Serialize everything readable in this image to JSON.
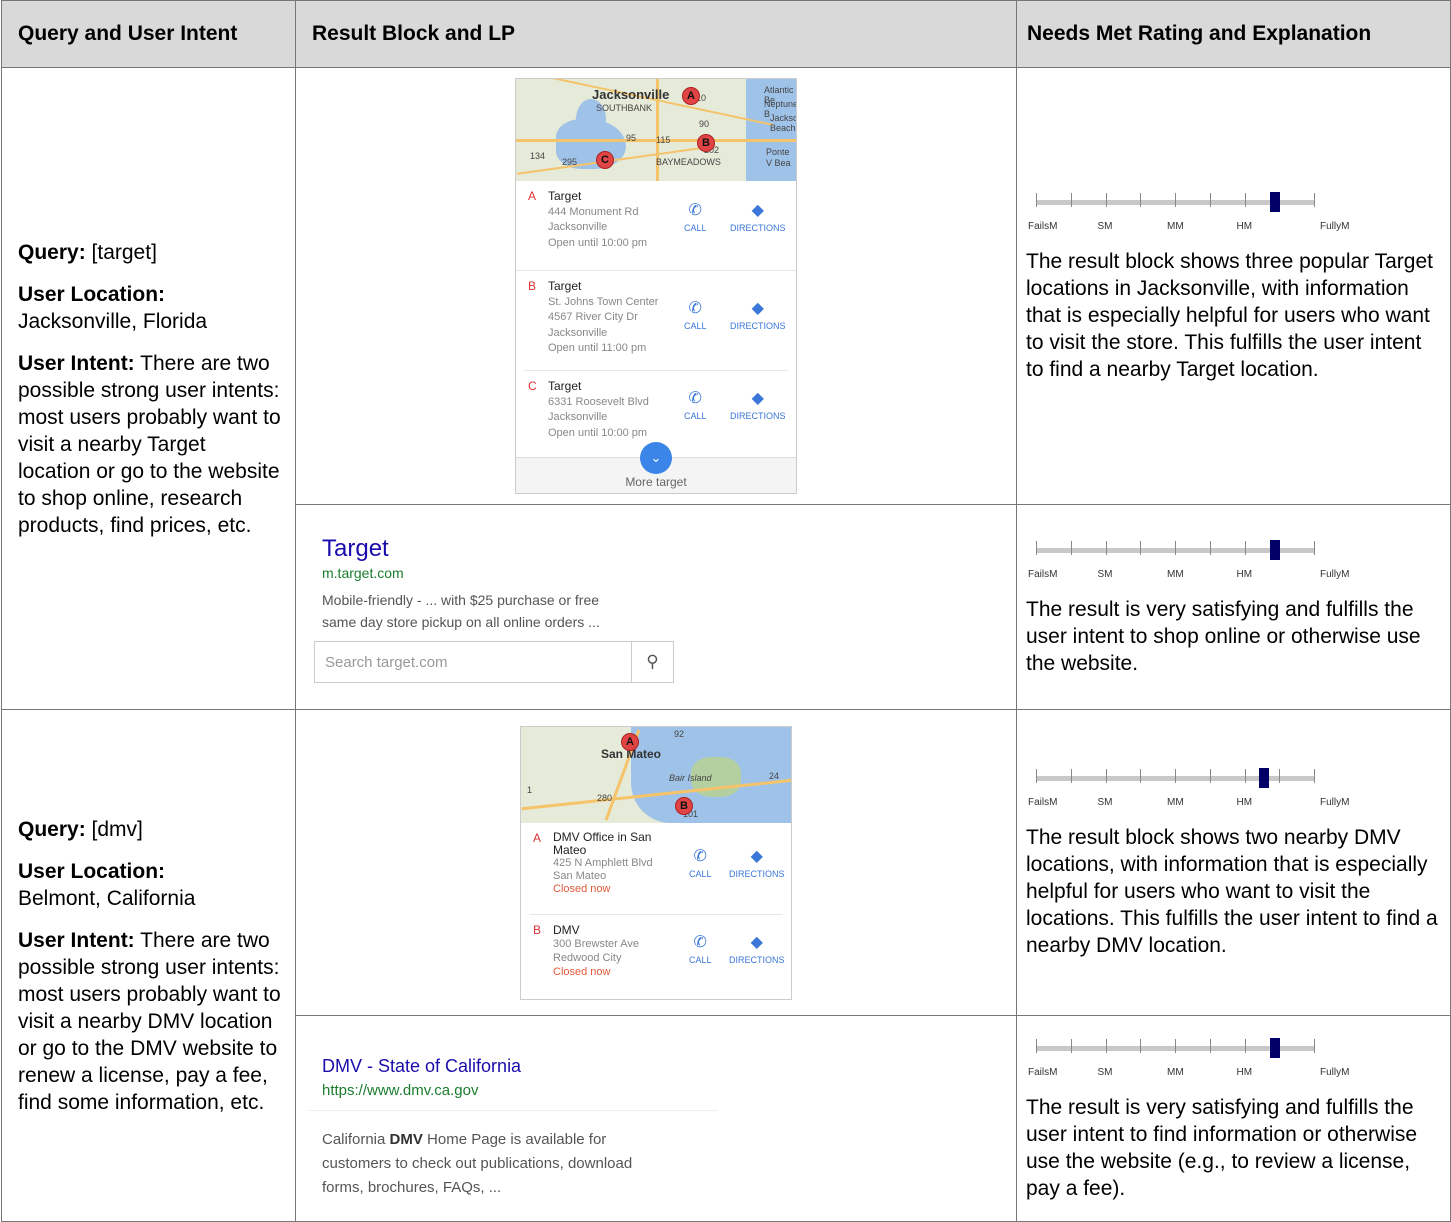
{
  "headers": [
    "Query and User Intent",
    "Result Block and LP",
    "Needs Met Rating and Explanation"
  ],
  "scale_labels": [
    "FailsM",
    "SM",
    "MM",
    "HM",
    "FullyM"
  ],
  "rows": [
    {
      "query_label": "Query:",
      "query": "[target]",
      "location_label": "User Location:",
      "location": "Jacksonville, Florida",
      "intent_label": "User Intent:",
      "intent": "There are two possible strong user intents: most users probably want to visit a nearby Target location or go to the website to shop online, research products, find prices, etc.",
      "results": [
        {
          "type": "local",
          "map": {
            "city": "Jacksonville",
            "labels": [
              "Atlantic Be",
              "Neptune B",
              "Jackson Beach",
              "Ponte V Bea",
              "SOUTHBANK",
              "BAYMEADOWS"
            ],
            "road_numbers": [
              "10",
              "90",
              "115",
              "202",
              "134",
              "295",
              "95"
            ],
            "pins": [
              "A",
              "B",
              "C"
            ]
          },
          "locations": [
            {
              "letter": "A",
              "name": "Target",
              "lines": [
                "444 Monument Rd",
                "Jacksonville",
                "Open until 10:00 pm"
              ]
            },
            {
              "letter": "B",
              "name": "Target",
              "lines": [
                "St. Johns Town Center",
                "4567 River City Dr",
                "Jacksonville",
                "Open until 11:00 pm"
              ]
            },
            {
              "letter": "C",
              "name": "Target",
              "lines": [
                "6331 Roosevelt Blvd",
                "Jacksonville",
                "Open until 10:00 pm"
              ]
            }
          ],
          "call_label": "CALL",
          "directions_label": "DIRECTIONS",
          "more_label": "More target",
          "rating": 0.86,
          "explanation": "The result block shows three popular Target locations in Jacksonville, with information that is especially helpful for users who want to visit the store. This fulfills the user intent to find a nearby Target location."
        },
        {
          "type": "web",
          "title": "Target",
          "url": "m.target.com",
          "snippet": [
            "Mobile-friendly - ... with $25 purchase or free",
            "same day store pickup on all online orders ..."
          ],
          "search_placeholder": "Search target.com",
          "rating": 0.86,
          "explanation": "The result is very satisfying and fulfills the user intent to shop online or otherwise use the website."
        }
      ]
    },
    {
      "query_label": "Query:",
      "query": "[dmv]",
      "location_label": "User Location:",
      "location": "Belmont, California",
      "intent_label": "User Intent:",
      "intent": "There are two possible strong user intents: most users probably want to visit a nearby DMV location or go to the DMV website to renew a license, pay a fee, find some information, etc.",
      "results": [
        {
          "type": "local",
          "map": {
            "city": "San Mateo",
            "labels": [
              "Bair Island"
            ],
            "road_numbers": [
              "92",
              "24",
              "101",
              "280",
              "1"
            ],
            "pins": [
              "A",
              "B"
            ]
          },
          "locations": [
            {
              "letter": "A",
              "name": "DMV Office in San Mateo",
              "lines": [
                "425 N Amphlett Blvd",
                "San Mateo"
              ],
              "status": "Closed now"
            },
            {
              "letter": "B",
              "name": "DMV",
              "lines": [
                "300 Brewster Ave",
                "Redwood City"
              ],
              "status": "Closed now"
            }
          ],
          "call_label": "CALL",
          "directions_label": "DIRECTIONS",
          "rating": 0.82,
          "explanation": "The result block shows two nearby DMV locations, with information that is especially helpful for users who want to visit the locations.  This fulfills the user intent to find a nearby DMV location."
        },
        {
          "type": "web",
          "title": "DMV - State of California",
          "url": "https://www.dmv.ca.gov",
          "snippet_bold": "DMV",
          "snippet_parts": [
            "California ",
            " Home Page is available for",
            "customers to check out publications, download",
            "forms, brochures, FAQs, ..."
          ],
          "rating": 0.86,
          "explanation": "The result is very satisfying and fulfills the user intent to find information or otherwise use the website (e.g., to review a license, pay a fee)."
        }
      ]
    }
  ]
}
